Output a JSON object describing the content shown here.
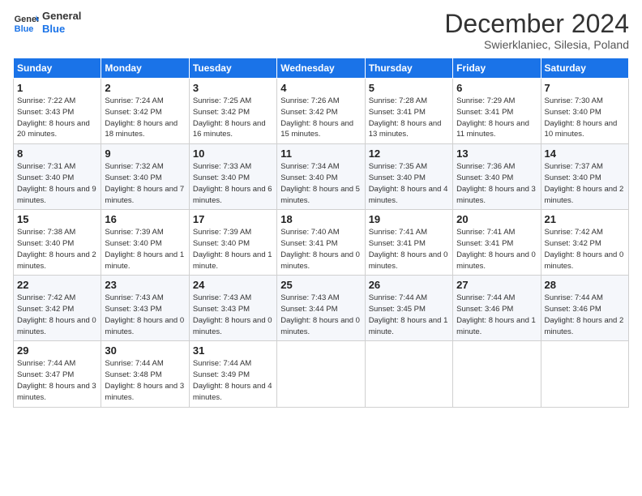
{
  "header": {
    "logo_general": "General",
    "logo_blue": "Blue",
    "month_title": "December 2024",
    "subtitle": "Swierklaniec, Silesia, Poland"
  },
  "days_of_week": [
    "Sunday",
    "Monday",
    "Tuesday",
    "Wednesday",
    "Thursday",
    "Friday",
    "Saturday"
  ],
  "weeks": [
    [
      {
        "day": "1",
        "sunrise": "7:22 AM",
        "sunset": "3:43 PM",
        "daylight": "8 hours and 20 minutes."
      },
      {
        "day": "2",
        "sunrise": "7:24 AM",
        "sunset": "3:42 PM",
        "daylight": "8 hours and 18 minutes."
      },
      {
        "day": "3",
        "sunrise": "7:25 AM",
        "sunset": "3:42 PM",
        "daylight": "8 hours and 16 minutes."
      },
      {
        "day": "4",
        "sunrise": "7:26 AM",
        "sunset": "3:42 PM",
        "daylight": "8 hours and 15 minutes."
      },
      {
        "day": "5",
        "sunrise": "7:28 AM",
        "sunset": "3:41 PM",
        "daylight": "8 hours and 13 minutes."
      },
      {
        "day": "6",
        "sunrise": "7:29 AM",
        "sunset": "3:41 PM",
        "daylight": "8 hours and 11 minutes."
      },
      {
        "day": "7",
        "sunrise": "7:30 AM",
        "sunset": "3:40 PM",
        "daylight": "8 hours and 10 minutes."
      }
    ],
    [
      {
        "day": "8",
        "sunrise": "7:31 AM",
        "sunset": "3:40 PM",
        "daylight": "8 hours and 9 minutes."
      },
      {
        "day": "9",
        "sunrise": "7:32 AM",
        "sunset": "3:40 PM",
        "daylight": "8 hours and 7 minutes."
      },
      {
        "day": "10",
        "sunrise": "7:33 AM",
        "sunset": "3:40 PM",
        "daylight": "8 hours and 6 minutes."
      },
      {
        "day": "11",
        "sunrise": "7:34 AM",
        "sunset": "3:40 PM",
        "daylight": "8 hours and 5 minutes."
      },
      {
        "day": "12",
        "sunrise": "7:35 AM",
        "sunset": "3:40 PM",
        "daylight": "8 hours and 4 minutes."
      },
      {
        "day": "13",
        "sunrise": "7:36 AM",
        "sunset": "3:40 PM",
        "daylight": "8 hours and 3 minutes."
      },
      {
        "day": "14",
        "sunrise": "7:37 AM",
        "sunset": "3:40 PM",
        "daylight": "8 hours and 2 minutes."
      }
    ],
    [
      {
        "day": "15",
        "sunrise": "7:38 AM",
        "sunset": "3:40 PM",
        "daylight": "8 hours and 2 minutes."
      },
      {
        "day": "16",
        "sunrise": "7:39 AM",
        "sunset": "3:40 PM",
        "daylight": "8 hours and 1 minute."
      },
      {
        "day": "17",
        "sunrise": "7:39 AM",
        "sunset": "3:40 PM",
        "daylight": "8 hours and 1 minute."
      },
      {
        "day": "18",
        "sunrise": "7:40 AM",
        "sunset": "3:41 PM",
        "daylight": "8 hours and 0 minutes."
      },
      {
        "day": "19",
        "sunrise": "7:41 AM",
        "sunset": "3:41 PM",
        "daylight": "8 hours and 0 minutes."
      },
      {
        "day": "20",
        "sunrise": "7:41 AM",
        "sunset": "3:41 PM",
        "daylight": "8 hours and 0 minutes."
      },
      {
        "day": "21",
        "sunrise": "7:42 AM",
        "sunset": "3:42 PM",
        "daylight": "8 hours and 0 minutes."
      }
    ],
    [
      {
        "day": "22",
        "sunrise": "7:42 AM",
        "sunset": "3:42 PM",
        "daylight": "8 hours and 0 minutes."
      },
      {
        "day": "23",
        "sunrise": "7:43 AM",
        "sunset": "3:43 PM",
        "daylight": "8 hours and 0 minutes."
      },
      {
        "day": "24",
        "sunrise": "7:43 AM",
        "sunset": "3:43 PM",
        "daylight": "8 hours and 0 minutes."
      },
      {
        "day": "25",
        "sunrise": "7:43 AM",
        "sunset": "3:44 PM",
        "daylight": "8 hours and 0 minutes."
      },
      {
        "day": "26",
        "sunrise": "7:44 AM",
        "sunset": "3:45 PM",
        "daylight": "8 hours and 1 minute."
      },
      {
        "day": "27",
        "sunrise": "7:44 AM",
        "sunset": "3:46 PM",
        "daylight": "8 hours and 1 minute."
      },
      {
        "day": "28",
        "sunrise": "7:44 AM",
        "sunset": "3:46 PM",
        "daylight": "8 hours and 2 minutes."
      }
    ],
    [
      {
        "day": "29",
        "sunrise": "7:44 AM",
        "sunset": "3:47 PM",
        "daylight": "8 hours and 3 minutes."
      },
      {
        "day": "30",
        "sunrise": "7:44 AM",
        "sunset": "3:48 PM",
        "daylight": "8 hours and 3 minutes."
      },
      {
        "day": "31",
        "sunrise": "7:44 AM",
        "sunset": "3:49 PM",
        "daylight": "8 hours and 4 minutes."
      },
      null,
      null,
      null,
      null
    ]
  ],
  "labels": {
    "sunrise": "Sunrise:",
    "sunset": "Sunset:",
    "daylight": "Daylight:"
  }
}
